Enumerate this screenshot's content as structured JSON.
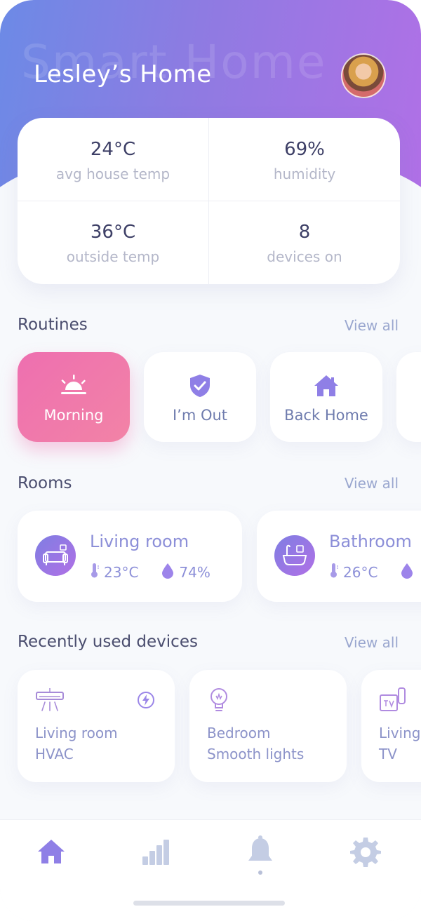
{
  "header": {
    "watermark": "Smart Home",
    "title": "Lesley’s Home"
  },
  "stats": [
    {
      "value": "24°C",
      "label": "avg house temp"
    },
    {
      "value": "69%",
      "label": "humidity"
    },
    {
      "value": "36°C",
      "label": "outside temp"
    },
    {
      "value": "8",
      "label": "devices on"
    }
  ],
  "routines": {
    "title": "Routines",
    "view_all": "View all",
    "items": [
      {
        "label": "Morning",
        "icon": "sunrise-icon",
        "active": true
      },
      {
        "label": "I’m Out",
        "icon": "shield-check-icon",
        "active": false
      },
      {
        "label": "Back Home",
        "icon": "house-icon",
        "active": false
      }
    ]
  },
  "rooms": {
    "title": "Rooms",
    "view_all": "View all",
    "items": [
      {
        "name": "Living room",
        "temp": "23°C",
        "humidity": "74%",
        "icon": "sofa-icon"
      },
      {
        "name": "Bathroom",
        "temp": "26°C",
        "humidity": "",
        "icon": "bathtub-icon"
      }
    ]
  },
  "devices": {
    "title": "Recently used devices",
    "view_all": "View all",
    "items": [
      {
        "room": "Living room",
        "name": "HVAC",
        "icon": "air-conditioner-icon"
      },
      {
        "room": "Bedroom",
        "name": "Smooth lights",
        "icon": "light-bulb-icon"
      },
      {
        "room": "Living",
        "name": "TV",
        "icon": "tv-remote-icon"
      }
    ]
  },
  "tabbar": {
    "items": [
      "home-icon",
      "stats-bars-icon",
      "bell-icon",
      "gear-icon"
    ],
    "active": "home-icon"
  },
  "colors": {
    "gradient_start": "#6c8ae6",
    "gradient_end": "#b070e6",
    "routine_active": "#ee6fb0",
    "accent_purple": "#8c8fd8"
  }
}
